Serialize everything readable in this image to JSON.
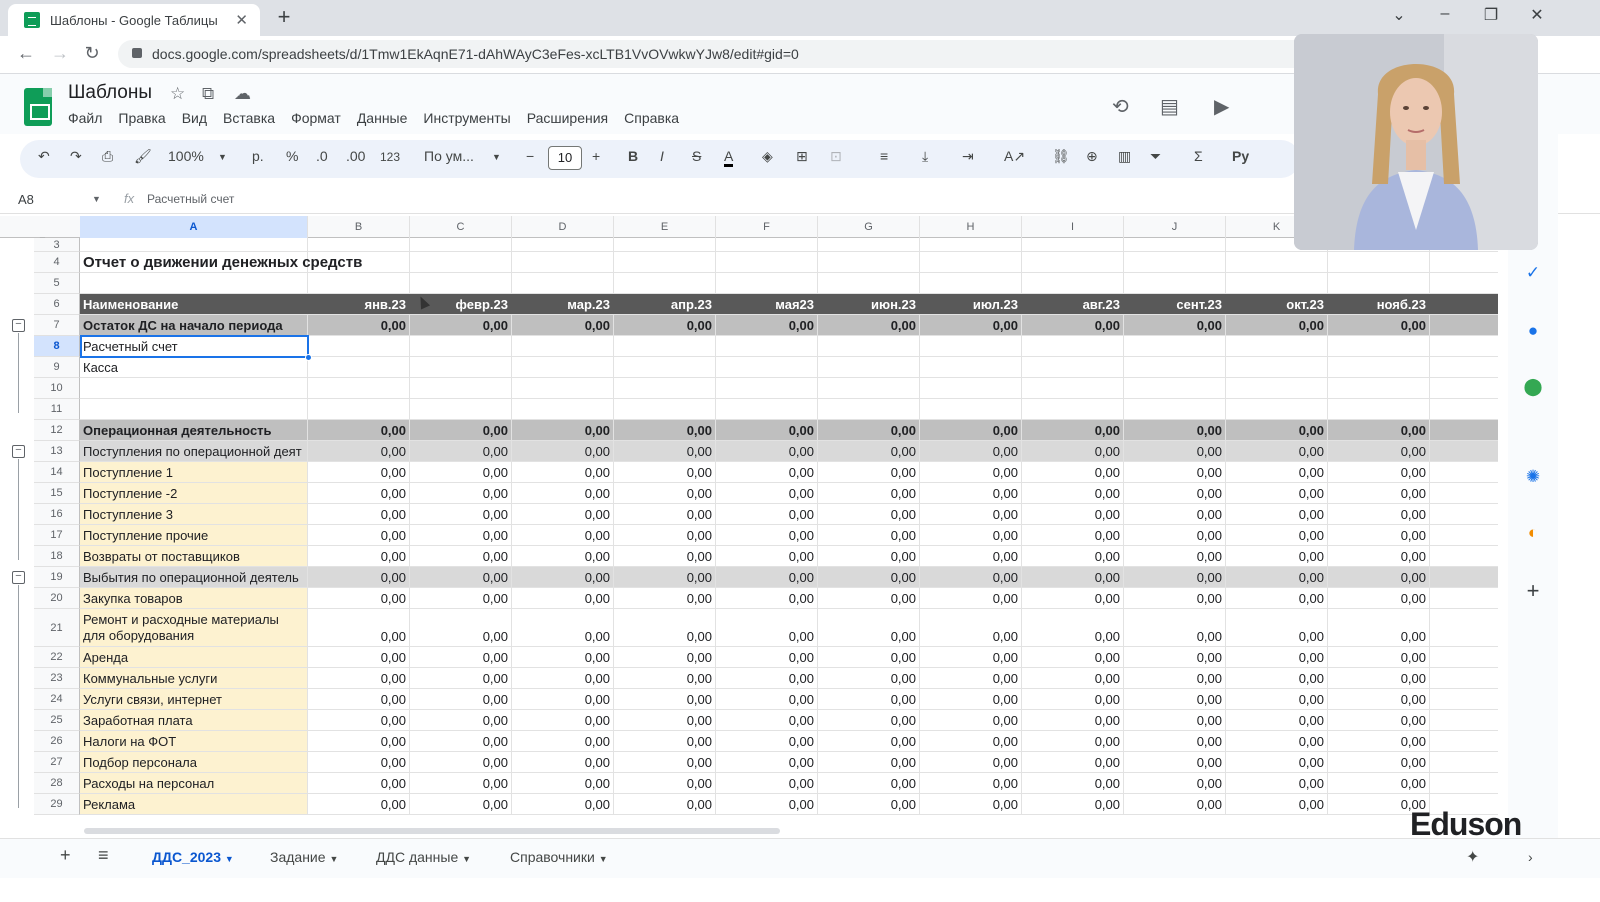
{
  "browser": {
    "tab_title": "Шаблоны - Google Таблицы",
    "url": "docs.google.com/spreadsheets/d/1Tmw1EkAqnE71-dAhWAyC3eFes-xcLTB1VvOVwkwYJw8/edit#gid=0"
  },
  "doc": {
    "title": "Шаблоны",
    "menus": [
      "Файл",
      "Правка",
      "Вид",
      "Вставка",
      "Формат",
      "Данные",
      "Инструменты",
      "Расширения",
      "Справка"
    ]
  },
  "toolbar": {
    "zoom": "100%",
    "currency": "р.",
    "percent": "%",
    "dec_minus": ".0",
    "dec_plus": ".00",
    "number_format": "123",
    "font": "По ум...",
    "font_size": "10"
  },
  "formula_bar": {
    "cell_ref": "A8",
    "fx": "fx",
    "content": "Расчетный счет"
  },
  "columns": [
    "A",
    "B",
    "C",
    "D",
    "E",
    "F",
    "G",
    "H",
    "I",
    "J",
    "K"
  ],
  "header_labels": [
    "Наименование",
    "янв.23",
    "февр.23",
    "мар.23",
    "апр.23",
    "мая23",
    "июн.23",
    "июл.23",
    "авг.23",
    "сент.23",
    "окт.23",
    "нояб.23"
  ],
  "report_title": "Отчет о движении денежных средств",
  "zero": "0,00",
  "rows": [
    {
      "n": "3",
      "type": "blank",
      "label": ""
    },
    {
      "n": "4",
      "type": "title",
      "label": "Отчет о движении денежных средств"
    },
    {
      "n": "5",
      "type": "blank",
      "label": ""
    },
    {
      "n": "6",
      "type": "hdr",
      "label": "Наименование"
    },
    {
      "n": "7",
      "type": "bold",
      "label": "Остаток ДС на начало периода"
    },
    {
      "n": "8",
      "type": "plain",
      "label": "Расчетный счет"
    },
    {
      "n": "9",
      "type": "plain",
      "label": "Касса"
    },
    {
      "n": "10",
      "type": "blank",
      "label": ""
    },
    {
      "n": "11",
      "type": "blank",
      "label": ""
    },
    {
      "n": "12",
      "type": "bold",
      "label": "Операционная деятельность"
    },
    {
      "n": "13",
      "type": "sub",
      "label": "Поступления по операционной деят"
    },
    {
      "n": "14",
      "type": "item",
      "label": "Поступление 1"
    },
    {
      "n": "15",
      "type": "item",
      "label": "Поступление -2"
    },
    {
      "n": "16",
      "type": "item",
      "label": "Поступление 3"
    },
    {
      "n": "17",
      "type": "item",
      "label": "Поступление прочие"
    },
    {
      "n": "18",
      "type": "item",
      "label": "Возвраты от поставщиков"
    },
    {
      "n": "19",
      "type": "sub",
      "label": "Выбытия по операционной деятель"
    },
    {
      "n": "20",
      "type": "item",
      "label": "Закупка товаров"
    },
    {
      "n": "21",
      "type": "item multi",
      "label": "Ремонт и расходные материалы для оборудования"
    },
    {
      "n": "22",
      "type": "item",
      "label": "Аренда"
    },
    {
      "n": "23",
      "type": "item",
      "label": "Коммунальные услуги"
    },
    {
      "n": "24",
      "type": "item",
      "label": "Услуги связи, интернет"
    },
    {
      "n": "25",
      "type": "item",
      "label": "Заработная плата"
    },
    {
      "n": "26",
      "type": "item",
      "label": "Налоги на ФОТ"
    },
    {
      "n": "27",
      "type": "item",
      "label": "Подбор персонала"
    },
    {
      "n": "28",
      "type": "item",
      "label": "Расходы на персонал"
    },
    {
      "n": "29",
      "type": "item",
      "label": "Реклама"
    }
  ],
  "sheet_tabs": [
    "ДДС_2023",
    "Задание",
    "ДДС данные",
    "Справочники"
  ],
  "active_sheet": "ДДС_2023",
  "watermark": "Eduson",
  "colors": {
    "header_dark": "#595959",
    "bold_row": "#bfbfbf",
    "sub_row": "#d9d9d9",
    "item_label": "#fdf2d0",
    "selection": "#1a73e8",
    "sheets_green": "#0f9d58"
  }
}
